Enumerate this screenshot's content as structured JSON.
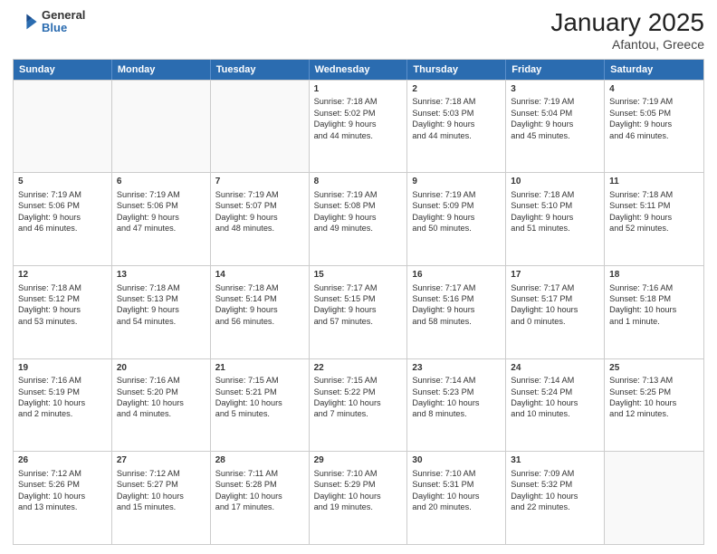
{
  "header": {
    "logo": {
      "general": "General",
      "blue": "Blue"
    },
    "title": "January 2025",
    "subtitle": "Afantou, Greece"
  },
  "days": [
    "Sunday",
    "Monday",
    "Tuesday",
    "Wednesday",
    "Thursday",
    "Friday",
    "Saturday"
  ],
  "rows": [
    [
      {
        "num": "",
        "text": ""
      },
      {
        "num": "",
        "text": ""
      },
      {
        "num": "",
        "text": ""
      },
      {
        "num": "1",
        "text": "Sunrise: 7:18 AM\nSunset: 5:02 PM\nDaylight: 9 hours\nand 44 minutes."
      },
      {
        "num": "2",
        "text": "Sunrise: 7:18 AM\nSunset: 5:03 PM\nDaylight: 9 hours\nand 44 minutes."
      },
      {
        "num": "3",
        "text": "Sunrise: 7:19 AM\nSunset: 5:04 PM\nDaylight: 9 hours\nand 45 minutes."
      },
      {
        "num": "4",
        "text": "Sunrise: 7:19 AM\nSunset: 5:05 PM\nDaylight: 9 hours\nand 46 minutes."
      }
    ],
    [
      {
        "num": "5",
        "text": "Sunrise: 7:19 AM\nSunset: 5:06 PM\nDaylight: 9 hours\nand 46 minutes."
      },
      {
        "num": "6",
        "text": "Sunrise: 7:19 AM\nSunset: 5:06 PM\nDaylight: 9 hours\nand 47 minutes."
      },
      {
        "num": "7",
        "text": "Sunrise: 7:19 AM\nSunset: 5:07 PM\nDaylight: 9 hours\nand 48 minutes."
      },
      {
        "num": "8",
        "text": "Sunrise: 7:19 AM\nSunset: 5:08 PM\nDaylight: 9 hours\nand 49 minutes."
      },
      {
        "num": "9",
        "text": "Sunrise: 7:19 AM\nSunset: 5:09 PM\nDaylight: 9 hours\nand 50 minutes."
      },
      {
        "num": "10",
        "text": "Sunrise: 7:18 AM\nSunset: 5:10 PM\nDaylight: 9 hours\nand 51 minutes."
      },
      {
        "num": "11",
        "text": "Sunrise: 7:18 AM\nSunset: 5:11 PM\nDaylight: 9 hours\nand 52 minutes."
      }
    ],
    [
      {
        "num": "12",
        "text": "Sunrise: 7:18 AM\nSunset: 5:12 PM\nDaylight: 9 hours\nand 53 minutes."
      },
      {
        "num": "13",
        "text": "Sunrise: 7:18 AM\nSunset: 5:13 PM\nDaylight: 9 hours\nand 54 minutes."
      },
      {
        "num": "14",
        "text": "Sunrise: 7:18 AM\nSunset: 5:14 PM\nDaylight: 9 hours\nand 56 minutes."
      },
      {
        "num": "15",
        "text": "Sunrise: 7:17 AM\nSunset: 5:15 PM\nDaylight: 9 hours\nand 57 minutes."
      },
      {
        "num": "16",
        "text": "Sunrise: 7:17 AM\nSunset: 5:16 PM\nDaylight: 9 hours\nand 58 minutes."
      },
      {
        "num": "17",
        "text": "Sunrise: 7:17 AM\nSunset: 5:17 PM\nDaylight: 10 hours\nand 0 minutes."
      },
      {
        "num": "18",
        "text": "Sunrise: 7:16 AM\nSunset: 5:18 PM\nDaylight: 10 hours\nand 1 minute."
      }
    ],
    [
      {
        "num": "19",
        "text": "Sunrise: 7:16 AM\nSunset: 5:19 PM\nDaylight: 10 hours\nand 2 minutes."
      },
      {
        "num": "20",
        "text": "Sunrise: 7:16 AM\nSunset: 5:20 PM\nDaylight: 10 hours\nand 4 minutes."
      },
      {
        "num": "21",
        "text": "Sunrise: 7:15 AM\nSunset: 5:21 PM\nDaylight: 10 hours\nand 5 minutes."
      },
      {
        "num": "22",
        "text": "Sunrise: 7:15 AM\nSunset: 5:22 PM\nDaylight: 10 hours\nand 7 minutes."
      },
      {
        "num": "23",
        "text": "Sunrise: 7:14 AM\nSunset: 5:23 PM\nDaylight: 10 hours\nand 8 minutes."
      },
      {
        "num": "24",
        "text": "Sunrise: 7:14 AM\nSunset: 5:24 PM\nDaylight: 10 hours\nand 10 minutes."
      },
      {
        "num": "25",
        "text": "Sunrise: 7:13 AM\nSunset: 5:25 PM\nDaylight: 10 hours\nand 12 minutes."
      }
    ],
    [
      {
        "num": "26",
        "text": "Sunrise: 7:12 AM\nSunset: 5:26 PM\nDaylight: 10 hours\nand 13 minutes."
      },
      {
        "num": "27",
        "text": "Sunrise: 7:12 AM\nSunset: 5:27 PM\nDaylight: 10 hours\nand 15 minutes."
      },
      {
        "num": "28",
        "text": "Sunrise: 7:11 AM\nSunset: 5:28 PM\nDaylight: 10 hours\nand 17 minutes."
      },
      {
        "num": "29",
        "text": "Sunrise: 7:10 AM\nSunset: 5:29 PM\nDaylight: 10 hours\nand 19 minutes."
      },
      {
        "num": "30",
        "text": "Sunrise: 7:10 AM\nSunset: 5:31 PM\nDaylight: 10 hours\nand 20 minutes."
      },
      {
        "num": "31",
        "text": "Sunrise: 7:09 AM\nSunset: 5:32 PM\nDaylight: 10 hours\nand 22 minutes."
      },
      {
        "num": "",
        "text": ""
      }
    ]
  ]
}
